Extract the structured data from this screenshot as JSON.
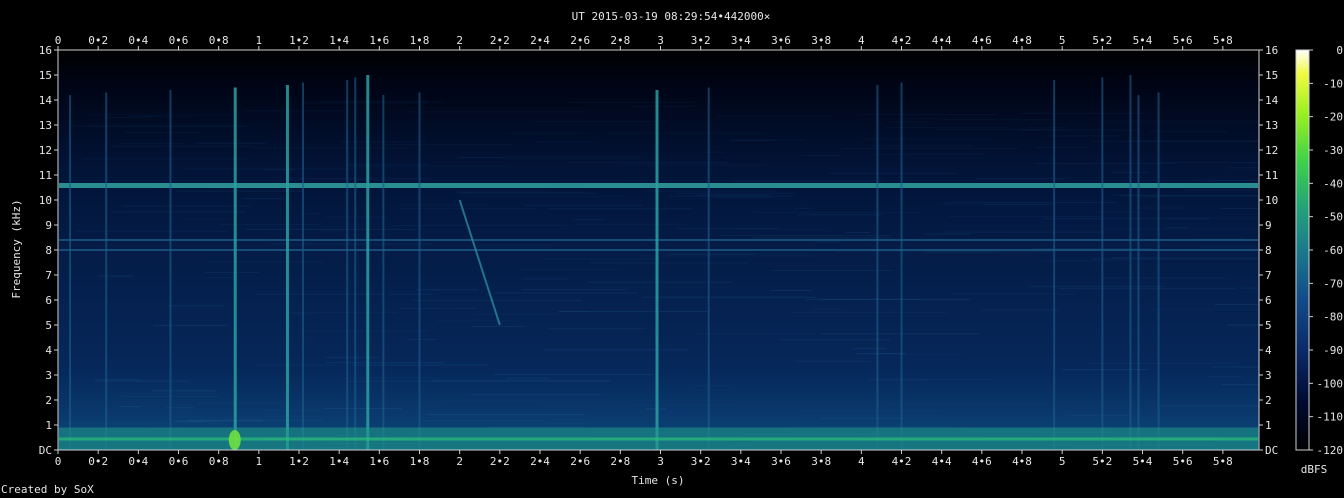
{
  "chart_data": {
    "type": "heatmap",
    "title": "UT 2015-03-19 08:29:54•442000×",
    "xlabel": "Time (s)",
    "ylabel": "Frequency (kHz)",
    "xlim": [
      0,
      5.98
    ],
    "ylim": [
      0,
      16
    ],
    "x_ticks": [
      "0",
      "0•2",
      "0•4",
      "0•6",
      "0•8",
      "1",
      "1•2",
      "1•4",
      "1•6",
      "1•8",
      "2",
      "2•2",
      "2•4",
      "2•6",
      "2•8",
      "3",
      "3•2",
      "3•4",
      "3•6",
      "3•8",
      "4",
      "4•2",
      "4•4",
      "4•6",
      "4•8",
      "5",
      "5•2",
      "5•4",
      "5•6",
      "5•8"
    ],
    "y_ticks": [
      "DC",
      "1",
      "2",
      "3",
      "4",
      "5",
      "6",
      "7",
      "8",
      "9",
      "10",
      "11",
      "12",
      "13",
      "14",
      "15",
      "16"
    ],
    "colorbar": {
      "label": "dBFS",
      "range": [
        -120,
        0
      ],
      "ticks": [
        "0",
        "-10",
        "-20",
        "-30",
        "-40",
        "-50",
        "-60",
        "-70",
        "-80",
        "-90",
        "-100",
        "-110",
        "-120"
      ]
    },
    "features": {
      "horizontal_lines_khz": [
        10.6,
        8.4,
        8.0
      ],
      "vertical_impulses_s": [
        0.06,
        0.24,
        0.56,
        0.88,
        1.14,
        1.22,
        1.44,
        1.48,
        1.54,
        1.62,
        1.8,
        2.98,
        3.24,
        4.08,
        4.2,
        4.96,
        5.2,
        5.34,
        5.38,
        5.48
      ],
      "chirp": {
        "start": [
          2.0,
          10.0
        ],
        "end": [
          2.2,
          5.0
        ]
      }
    }
  },
  "footer": {
    "credit": "Created by SoX"
  },
  "colors": {
    "background": "#000000",
    "text": "#e6e6e6",
    "colormap": [
      "#000000",
      "#000a30",
      "#0b2a6a",
      "#124c8a",
      "#1a7a8c",
      "#22a07a",
      "#3cd24a",
      "#9af020",
      "#f0fa40",
      "#ffffff"
    ]
  }
}
